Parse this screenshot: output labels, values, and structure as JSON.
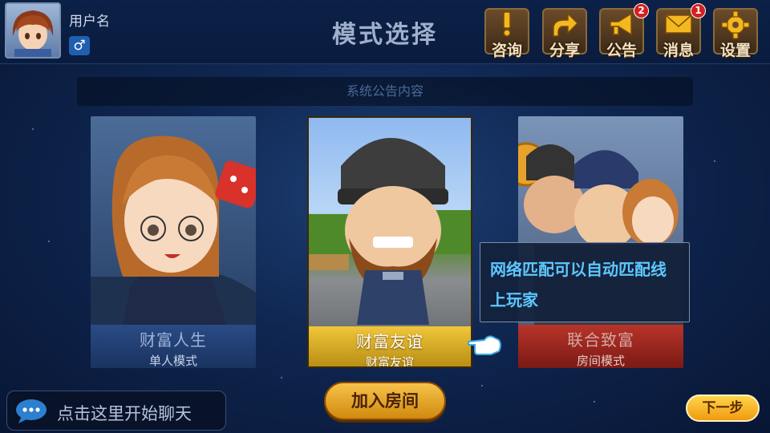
{
  "header": {
    "username": "用户名",
    "gender_symbol": "♂",
    "title": "模式选择",
    "buttons": [
      {
        "label": "咨询",
        "icon": "exclamation-icon",
        "badge": null
      },
      {
        "label": "分享",
        "icon": "share-arrow-icon",
        "badge": null
      },
      {
        "label": "公告",
        "icon": "megaphone-icon",
        "badge": "2"
      },
      {
        "label": "消息",
        "icon": "envelope-icon",
        "badge": "1"
      },
      {
        "label": "设置",
        "icon": "gear-icon",
        "badge": null
      }
    ]
  },
  "notice": {
    "text": "系统公告内容"
  },
  "modes": [
    {
      "title": "财富人生",
      "subtitle": "单人模式",
      "state": "dimmed"
    },
    {
      "title": "财富友谊",
      "subtitle": "财富友谊",
      "state": "selected"
    },
    {
      "title": "联合致富",
      "subtitle": "房间模式",
      "state": "dimmed"
    }
  ],
  "tooltip": {
    "text": "网络匹配可以自动匹配线上玩家"
  },
  "chat": {
    "placeholder": "点击这里开始聊天",
    "icon": "chat-bubble-icon"
  },
  "actions": {
    "join_room": "加入房间",
    "next_step": "下一步"
  },
  "colors": {
    "background": "#0f2650",
    "gold_button": "#f0b22a",
    "tooltip_text": "#5cc8ff",
    "badge": "#d52020"
  }
}
